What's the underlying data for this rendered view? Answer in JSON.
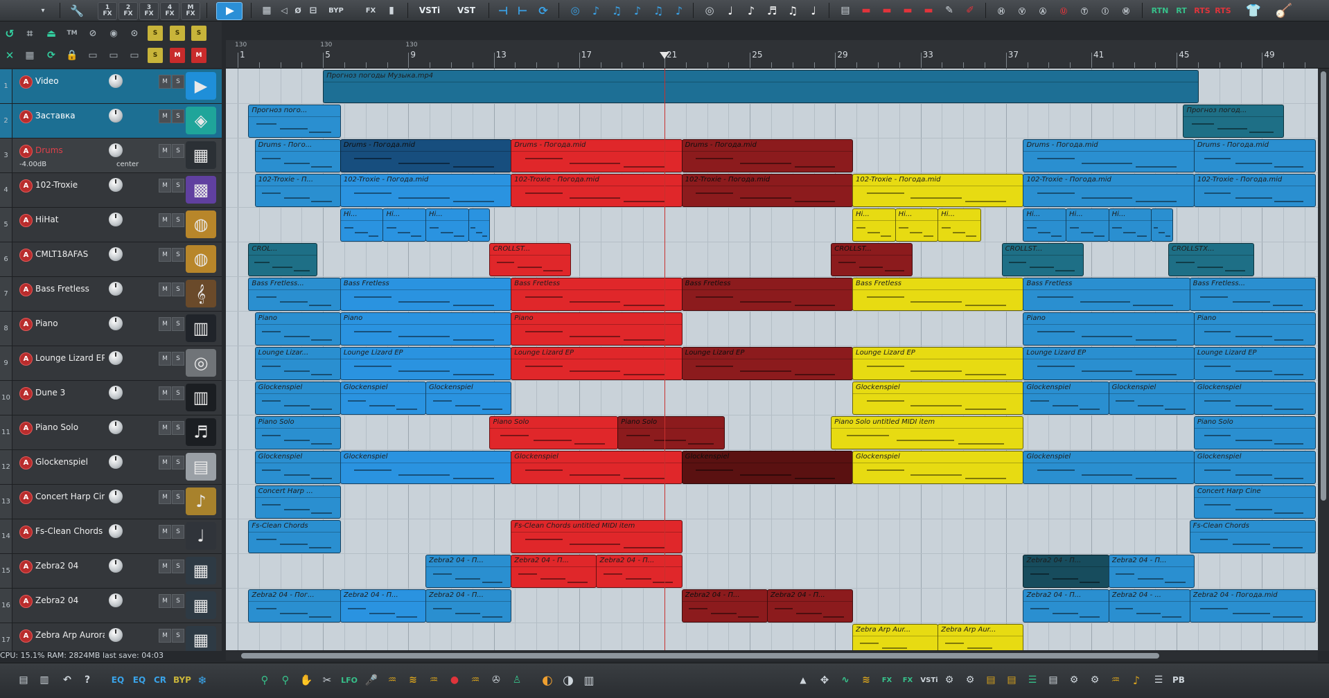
{
  "colors": {
    "accent": "#2a8fd0",
    "selected_track": "#1c6f93",
    "clip_red": "#e0272a",
    "clip_yellow": "#e7db12",
    "playhead": "#c8302e"
  },
  "toolbar": {
    "fx_keys": [
      {
        "num": "1",
        "label": "FX"
      },
      {
        "num": "2",
        "label": "FX"
      },
      {
        "num": "3",
        "label": "FX"
      },
      {
        "num": "4",
        "label": "FX"
      },
      {
        "num": "M",
        "label": "FX"
      }
    ],
    "byp_label": "BYP",
    "fx_label": "FX",
    "vsti_label": "VSTi",
    "vst_label": "VST",
    "rt_buttons": [
      "RTN",
      "RT",
      "RTS",
      "RTS"
    ]
  },
  "left_panel": {
    "tm_label": "TM",
    "s_label": "S",
    "m_label": "M"
  },
  "tracks": [
    {
      "num": "1",
      "name": "Video",
      "icon": "video-icon"
    },
    {
      "num": "2",
      "name": "Заставка",
      "icon": "waveform-icon"
    },
    {
      "num": "3",
      "name": "Drums",
      "icon": "drum-machine-icon",
      "volume": "-4.00dB",
      "pan": "center"
    },
    {
      "num": "4",
      "name": "102-Troxie",
      "icon": "synth-icon"
    },
    {
      "num": "5",
      "name": "HiHat",
      "icon": "cymbal-icon"
    },
    {
      "num": "6",
      "name": "CMLT18AFAS",
      "icon": "cymbal-icon"
    },
    {
      "num": "7",
      "name": "Bass Fretless",
      "icon": "guitar-icon"
    },
    {
      "num": "8",
      "name": "Piano",
      "icon": "piano-icon"
    },
    {
      "num": "9",
      "name": "Lounge Lizard EP",
      "icon": "ep-logo-icon"
    },
    {
      "num": "10",
      "name": "Dune 3",
      "icon": "keyboard-icon"
    },
    {
      "num": "11",
      "name": "Piano Solo",
      "icon": "grand-piano-icon"
    },
    {
      "num": "12",
      "name": "Glockenspiel",
      "icon": "glockenspiel-icon"
    },
    {
      "num": "13",
      "name": "Concert Harp Cine",
      "icon": "harp-icon"
    },
    {
      "num": "14",
      "name": "Fs-Clean Chords",
      "icon": "electric-guitar-icon"
    },
    {
      "num": "15",
      "name": "Zebra2 04",
      "icon": "zebra-synth-icon"
    },
    {
      "num": "16",
      "name": "Zebra2 04",
      "icon": "zebra-synth-icon"
    },
    {
      "num": "17",
      "name": "Zebra Arp Aurora",
      "icon": "zebra-synth-icon"
    }
  ],
  "mute_label": "M",
  "solo_label": "S",
  "arm_label": "A",
  "status": "CPU: 15.1%  RAM: 2824MB  last save: 04:03",
  "ruler": {
    "bars": [
      "1",
      "5",
      "9",
      "13",
      "17",
      "21",
      "25",
      "29",
      "33",
      "37",
      "41",
      "45",
      "49"
    ],
    "tempo_marks": [
      "130",
      "130",
      "130"
    ],
    "playhead_bar": "21"
  },
  "clips": [
    {
      "lane": 0,
      "start": 5,
      "end": 46,
      "color": "vid",
      "name": "Прогноз погоды Музыка.mp4"
    },
    {
      "lane": 1,
      "start": 1.5,
      "end": 5.8,
      "color": "blue",
      "name": "Прогноз пого..."
    },
    {
      "lane": 1,
      "start": 45.3,
      "end": 50,
      "color": "teal",
      "name": "Прогноз погод..."
    },
    {
      "lane": 2,
      "start": 1.8,
      "end": 5.8,
      "color": "blue",
      "name": "Drums - Пого..."
    },
    {
      "lane": 2,
      "start": 5.8,
      "end": 13.8,
      "color": "navy",
      "name": "Drums - Погода.mid"
    },
    {
      "lane": 2,
      "start": 13.8,
      "end": 21.8,
      "color": "red",
      "name": "Drums - Погода.mid"
    },
    {
      "lane": 2,
      "start": 21.8,
      "end": 29.8,
      "color": "dred",
      "name": "Drums - Погода.mid"
    },
    {
      "lane": 2,
      "start": 37.8,
      "end": 45.8,
      "color": "blue",
      "name": "Drums - Погода.mid"
    },
    {
      "lane": 2,
      "start": 45.8,
      "end": 51.5,
      "color": "blue",
      "name": "Drums - Погода.mid"
    },
    {
      "lane": 3,
      "start": 1.8,
      "end": 5.8,
      "color": "blue",
      "name": "102-Troxie - П..."
    },
    {
      "lane": 3,
      "start": 5.8,
      "end": 13.8,
      "color": "blue2",
      "name": "102-Troxie - Погода.mid"
    },
    {
      "lane": 3,
      "start": 13.8,
      "end": 21.8,
      "color": "red",
      "name": "102-Troxie - Погода.mid"
    },
    {
      "lane": 3,
      "start": 21.8,
      "end": 29.8,
      "color": "dred",
      "name": "102-Troxie - Погода.mid"
    },
    {
      "lane": 3,
      "start": 29.8,
      "end": 37.8,
      "color": "yellow",
      "name": "102-Troxie - Погода.mid"
    },
    {
      "lane": 3,
      "start": 37.8,
      "end": 45.8,
      "color": "blue",
      "name": "102-Troxie - Погода.mid"
    },
    {
      "lane": 3,
      "start": 45.8,
      "end": 51.5,
      "color": "blue",
      "name": "102-Troxie - Погода.mid"
    },
    {
      "lane": 4,
      "start": 5.8,
      "end": 7.8,
      "color": "blue2",
      "name": "Hi..."
    },
    {
      "lane": 4,
      "start": 7.8,
      "end": 9.8,
      "color": "blue2",
      "name": "Hi..."
    },
    {
      "lane": 4,
      "start": 9.8,
      "end": 11.8,
      "color": "blue2",
      "name": "Hi..."
    },
    {
      "lane": 4,
      "start": 11.8,
      "end": 12.8,
      "color": "blue2",
      "name": ""
    },
    {
      "lane": 4,
      "start": 29.8,
      "end": 31.8,
      "color": "yellow",
      "name": "Hi..."
    },
    {
      "lane": 4,
      "start": 31.8,
      "end": 33.8,
      "color": "yellow",
      "name": "Hi..."
    },
    {
      "lane": 4,
      "start": 33.8,
      "end": 35.8,
      "color": "yellow",
      "name": "Hi..."
    },
    {
      "lane": 4,
      "start": 37.8,
      "end": 39.8,
      "color": "blue",
      "name": "Hi..."
    },
    {
      "lane": 4,
      "start": 39.8,
      "end": 41.8,
      "color": "blue",
      "name": "Hi..."
    },
    {
      "lane": 4,
      "start": 41.8,
      "end": 43.8,
      "color": "blue",
      "name": "Hi..."
    },
    {
      "lane": 4,
      "start": 43.8,
      "end": 44.8,
      "color": "blue",
      "name": ""
    },
    {
      "lane": 5,
      "start": 1.5,
      "end": 4.7,
      "color": "teal",
      "name": "CROL..."
    },
    {
      "lane": 5,
      "start": 12.8,
      "end": 16.6,
      "color": "red",
      "name": "CROLLST..."
    },
    {
      "lane": 5,
      "start": 28.8,
      "end": 32.6,
      "color": "dred",
      "name": "CROLLST..."
    },
    {
      "lane": 5,
      "start": 36.8,
      "end": 40.6,
      "color": "teal",
      "name": "CROLLST..."
    },
    {
      "lane": 5,
      "start": 44.6,
      "end": 48.6,
      "color": "teal",
      "name": "CROLLSTX..."
    },
    {
      "lane": 6,
      "start": 1.5,
      "end": 5.8,
      "color": "blue",
      "name": "Bass Fretless..."
    },
    {
      "lane": 6,
      "start": 5.8,
      "end": 13.8,
      "color": "blue2",
      "name": "Bass Fretless"
    },
    {
      "lane": 6,
      "start": 13.8,
      "end": 21.8,
      "color": "red",
      "name": "Bass Fretless"
    },
    {
      "lane": 6,
      "start": 21.8,
      "end": 29.8,
      "color": "dred",
      "name": "Bass Fretless"
    },
    {
      "lane": 6,
      "start": 29.8,
      "end": 37.8,
      "color": "yellow",
      "name": "Bass Fretless"
    },
    {
      "lane": 6,
      "start": 37.8,
      "end": 45.6,
      "color": "blue",
      "name": "Bass Fretless"
    },
    {
      "lane": 6,
      "start": 45.6,
      "end": 51.5,
      "color": "blue",
      "name": "Bass Fretless..."
    },
    {
      "lane": 7,
      "start": 1.8,
      "end": 5.8,
      "color": "blue",
      "name": "Piano"
    },
    {
      "lane": 7,
      "start": 5.8,
      "end": 13.8,
      "color": "blue2",
      "name": "Piano"
    },
    {
      "lane": 7,
      "start": 13.8,
      "end": 21.8,
      "color": "red",
      "name": "Piano"
    },
    {
      "lane": 7,
      "start": 37.8,
      "end": 45.8,
      "color": "blue",
      "name": "Piano"
    },
    {
      "lane": 7,
      "start": 45.8,
      "end": 51.5,
      "color": "blue",
      "name": "Piano"
    },
    {
      "lane": 8,
      "start": 1.8,
      "end": 5.8,
      "color": "blue",
      "name": "Lounge Lizar..."
    },
    {
      "lane": 8,
      "start": 5.8,
      "end": 13.8,
      "color": "blue2",
      "name": "Lounge Lizard EP"
    },
    {
      "lane": 8,
      "start": 13.8,
      "end": 21.8,
      "color": "red",
      "name": "Lounge Lizard EP"
    },
    {
      "lane": 8,
      "start": 21.8,
      "end": 29.8,
      "color": "dred",
      "name": "Lounge Lizard EP"
    },
    {
      "lane": 8,
      "start": 29.8,
      "end": 37.8,
      "color": "yellow",
      "name": "Lounge Lizard EP"
    },
    {
      "lane": 8,
      "start": 37.8,
      "end": 45.8,
      "color": "blue",
      "name": "Lounge Lizard EP"
    },
    {
      "lane": 8,
      "start": 45.8,
      "end": 51.5,
      "color": "blue",
      "name": "Lounge Lizard EP"
    },
    {
      "lane": 9,
      "start": 1.8,
      "end": 5.8,
      "color": "blue",
      "name": "Glockenspiel"
    },
    {
      "lane": 9,
      "start": 5.8,
      "end": 9.8,
      "color": "blue2",
      "name": "Glockenspiel"
    },
    {
      "lane": 9,
      "start": 9.8,
      "end": 13.8,
      "color": "blue2",
      "name": "Glockenspiel"
    },
    {
      "lane": 9,
      "start": 29.8,
      "end": 37.8,
      "color": "yellow",
      "name": "Glockenspiel"
    },
    {
      "lane": 9,
      "start": 37.8,
      "end": 41.8,
      "color": "blue",
      "name": "Glockenspiel"
    },
    {
      "lane": 9,
      "start": 41.8,
      "end": 45.8,
      "color": "blue",
      "name": "Glockenspiel"
    },
    {
      "lane": 9,
      "start": 45.8,
      "end": 51.5,
      "color": "blue",
      "name": "Glockenspiel"
    },
    {
      "lane": 10,
      "start": 1.8,
      "end": 5.8,
      "color": "blue",
      "name": "Piano Solo"
    },
    {
      "lane": 10,
      "start": 12.8,
      "end": 18.8,
      "color": "red",
      "name": "Piano Solo"
    },
    {
      "lane": 10,
      "start": 18.8,
      "end": 23.8,
      "color": "dred",
      "name": "Piano Solo"
    },
    {
      "lane": 10,
      "start": 28.8,
      "end": 37.8,
      "color": "yellow",
      "name": "Piano Solo untitled MIDI item"
    },
    {
      "lane": 10,
      "start": 45.8,
      "end": 51.5,
      "color": "blue",
      "name": "Piano Solo"
    },
    {
      "lane": 11,
      "start": 1.8,
      "end": 5.8,
      "color": "blue",
      "name": "Glockenspiel"
    },
    {
      "lane": 11,
      "start": 5.8,
      "end": 13.8,
      "color": "blue2",
      "name": "Glockenspiel"
    },
    {
      "lane": 11,
      "start": 13.8,
      "end": 21.8,
      "color": "red",
      "name": "Glockenspiel"
    },
    {
      "lane": 11,
      "start": 21.8,
      "end": 29.8,
      "color": "dred2",
      "name": "Glockenspiel"
    },
    {
      "lane": 11,
      "start": 29.8,
      "end": 37.8,
      "color": "yellow",
      "name": "Glockenspiel"
    },
    {
      "lane": 11,
      "start": 37.8,
      "end": 45.8,
      "color": "blue",
      "name": "Glockenspiel"
    },
    {
      "lane": 11,
      "start": 45.8,
      "end": 51.5,
      "color": "blue",
      "name": "Glockenspiel"
    },
    {
      "lane": 12,
      "start": 1.8,
      "end": 5.8,
      "color": "blue",
      "name": "Concert Harp ..."
    },
    {
      "lane": 12,
      "start": 45.8,
      "end": 51.5,
      "color": "blue",
      "name": "Concert Harp Cine"
    },
    {
      "lane": 13,
      "start": 1.5,
      "end": 5.8,
      "color": "blue",
      "name": "Fs-Clean Chords"
    },
    {
      "lane": 13,
      "start": 13.8,
      "end": 21.8,
      "color": "red",
      "name": "Fs-Clean Chords untitled MIDI item"
    },
    {
      "lane": 13,
      "start": 45.6,
      "end": 51.5,
      "color": "blue",
      "name": "Fs-Clean Chords"
    },
    {
      "lane": 14,
      "start": 9.8,
      "end": 13.8,
      "color": "blue",
      "name": "Zebra2 04 - П..."
    },
    {
      "lane": 14,
      "start": 13.8,
      "end": 17.8,
      "color": "red",
      "name": "Zebra2 04 - П..."
    },
    {
      "lane": 14,
      "start": 17.8,
      "end": 21.8,
      "color": "red",
      "name": "Zebra2 04 - П..."
    },
    {
      "lane": 14,
      "start": 37.8,
      "end": 41.8,
      "color": "dteal",
      "name": "Zebra2 04 - П..."
    },
    {
      "lane": 14,
      "start": 41.8,
      "end": 45.8,
      "color": "blue",
      "name": "Zebra2 04 - П..."
    },
    {
      "lane": 15,
      "start": 1.5,
      "end": 5.8,
      "color": "blue",
      "name": "Zebra2 04 - Пог..."
    },
    {
      "lane": 15,
      "start": 5.8,
      "end": 9.8,
      "color": "blue2",
      "name": "Zebra2 04 - П..."
    },
    {
      "lane": 15,
      "start": 9.8,
      "end": 13.8,
      "color": "blue",
      "name": "Zebra2 04 - П..."
    },
    {
      "lane": 15,
      "start": 21.8,
      "end": 25.8,
      "color": "dred",
      "name": "Zebra2 04 - П..."
    },
    {
      "lane": 15,
      "start": 25.8,
      "end": 29.8,
      "color": "dred",
      "name": "Zebra2 04 - П..."
    },
    {
      "lane": 15,
      "start": 37.8,
      "end": 41.8,
      "color": "blue",
      "name": "Zebra2 04 - П..."
    },
    {
      "lane": 15,
      "start": 41.8,
      "end": 45.6,
      "color": "blue",
      "name": "Zebra2 04 - ..."
    },
    {
      "lane": 15,
      "start": 45.6,
      "end": 51.5,
      "color": "blue",
      "name": "Zebra2 04 - Погода.mid"
    },
    {
      "lane": 16,
      "start": 29.8,
      "end": 33.8,
      "color": "yellow",
      "name": "Zebra Arp Aur..."
    },
    {
      "lane": 16,
      "start": 33.8,
      "end": 37.8,
      "color": "yellow",
      "name": "Zebra Arp Aur..."
    }
  ],
  "bottom": {
    "left_buttons": [
      "EQ",
      "EQ",
      "CR",
      "BYP"
    ],
    "lfo_label": "LFO",
    "pb_label": "PB"
  }
}
